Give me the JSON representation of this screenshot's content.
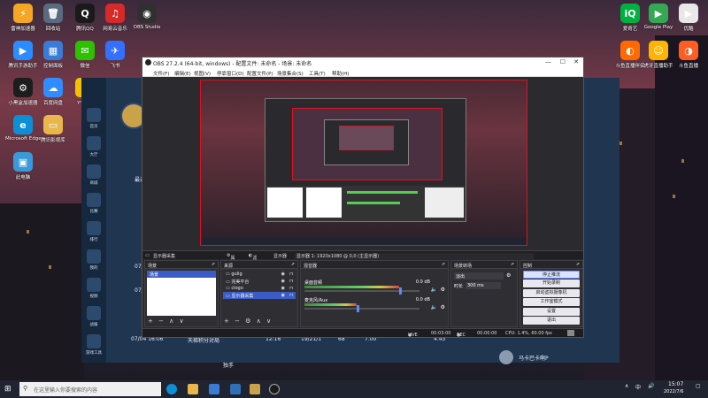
{
  "desktop": {
    "icons_left": [
      {
        "label": "雷神加速器",
        "glyph": "⚡",
        "color": "#f5a623"
      },
      {
        "label": "回收站",
        "glyph": "🗑",
        "color": "#5a6b80"
      },
      {
        "label": "腾讯QQ",
        "glyph": "Q",
        "color": "#1a1a1a"
      },
      {
        "label": "网易云音乐",
        "glyph": "♫",
        "color": "#d62a2a"
      },
      {
        "label": "OBS Studio",
        "glyph": "◉",
        "color": "#303030"
      },
      {
        "label": "腾讯手游助手",
        "glyph": "▶",
        "color": "#2a8cff"
      },
      {
        "label": "控制面板",
        "glyph": "▦",
        "color": "#3a7bd5"
      },
      {
        "label": "微信",
        "glyph": "✉",
        "color": "#2dc100"
      },
      {
        "label": "飞书",
        "glyph": "✈",
        "color": "#3370ff"
      },
      {
        "label": "小黑盒加速器",
        "glyph": "⚙",
        "color": "#1d1d1d"
      },
      {
        "label": "百度网盘",
        "glyph": "☁",
        "color": "#2f8dff"
      },
      {
        "label": "YY语音",
        "glyph": "Y",
        "color": "#f5c000"
      },
      {
        "label": "Microsoft Edge",
        "glyph": "e",
        "color": "#0c8fd6"
      },
      {
        "label": "腾讯影视库",
        "glyph": "▭",
        "color": "#e8b64a"
      },
      {
        "label": "此电脑",
        "glyph": "▣",
        "color": "#3a9ad9"
      }
    ],
    "icons_right": [
      {
        "label": "爱奇艺",
        "glyph": "iQ",
        "color": "#00b140"
      },
      {
        "label": "Google Play",
        "glyph": "▶",
        "color": "#34a853"
      },
      {
        "label": "优酷",
        "glyph": "▶",
        "color": "#e8e8e8"
      },
      {
        "label": "斗鱼直播伴侣",
        "glyph": "◐",
        "color": "#ff6a00"
      },
      {
        "label": "虎牙直播助手",
        "glyph": "☺",
        "color": "#ffb400"
      },
      {
        "label": "斗鱼直播",
        "glyph": "◑",
        "color": "#ff5d23"
      }
    ]
  },
  "bg_app": {
    "side_items": [
      "首页",
      "大厅",
      "商城",
      "比赛",
      "排行",
      "我的",
      "视频",
      "战报",
      "游戏工具"
    ],
    "rows": [
      {
        "date": "07/04",
        "text": ""
      },
      {
        "date": "07/04",
        "text": ""
      },
      {
        "date": "07/04 16:06",
        "text": "天梯积分对局",
        "time": "12:16",
        "score": "19/21/1",
        "a": "68",
        "b": "7.00",
        "c": "4.43"
      }
    ],
    "label_left": "最近",
    "user_right": "马卡巴卡啊P",
    "bottom_label": "独手"
  },
  "obs": {
    "title": "OBS 27.2.4 (64-bit, windows) - 配置文件: 未命名 - 场景: 未命名",
    "menu": [
      "文件(F)",
      "编辑(E)",
      "视图(V)",
      "停靠窗口(D)",
      "配置文件(P)",
      "场景集合(S)",
      "工具(T)",
      "帮助(H)"
    ],
    "source_bar": {
      "name": "显示器采集",
      "props": "属性",
      "filters": "滤镜",
      "display": "显示器",
      "display_val": "显示器 1: 1920x1080 @ 0,0 (主显示器)"
    },
    "scenes": {
      "header": "场景",
      "items": [
        "场景"
      ]
    },
    "sources": {
      "header": "来源",
      "items": [
        "gulig",
        "完美平台",
        "clogo",
        "显示器采集"
      ]
    },
    "mixer": {
      "header": "混音器",
      "channels": [
        {
          "name": "桌面音频",
          "db": "0.0 dB",
          "level": 0.82
        },
        {
          "name": "麦克风/Aux",
          "db": "0.0 dB",
          "level": 0.45
        }
      ]
    },
    "transitions": {
      "header": "场景转场",
      "type": "淡出",
      "duration_label": "时长",
      "duration": "300 ms"
    },
    "controls": {
      "header": "控制",
      "buttons": [
        "停止推流",
        "开始录制",
        "启动虚拟摄像机",
        "工作室模式",
        "设置",
        "退出"
      ]
    },
    "status": {
      "live": "LIVE",
      "live_time": "00:03:00",
      "rec": "REC",
      "rec_time": "00:00:00",
      "cpu": "CPU: 1.4%, 60.00 fps"
    }
  },
  "taskbar": {
    "search_placeholder": "在这里输入你要搜索的内容",
    "tray_lang": "中",
    "time": "15:07",
    "date": "2022/7/6"
  }
}
